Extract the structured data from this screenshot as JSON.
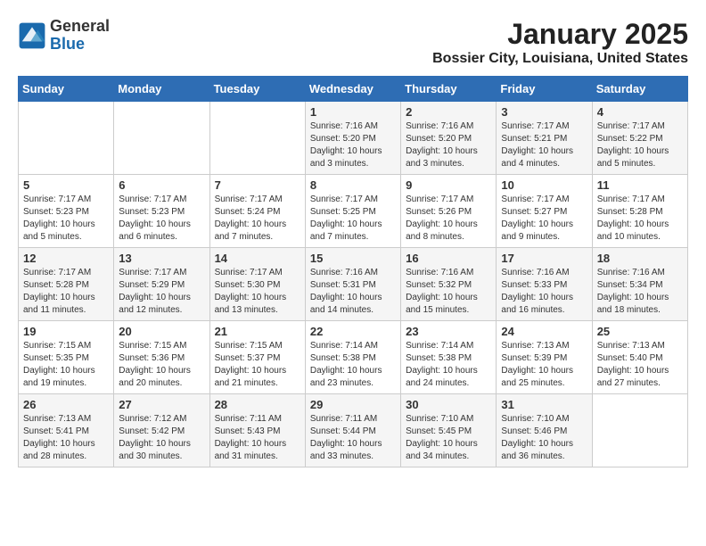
{
  "logo": {
    "general": "General",
    "blue": "Blue"
  },
  "header": {
    "month": "January 2025",
    "location": "Bossier City, Louisiana, United States"
  },
  "weekdays": [
    "Sunday",
    "Monday",
    "Tuesday",
    "Wednesday",
    "Thursday",
    "Friday",
    "Saturday"
  ],
  "weeks": [
    [
      {
        "day": "",
        "info": ""
      },
      {
        "day": "",
        "info": ""
      },
      {
        "day": "",
        "info": ""
      },
      {
        "day": "1",
        "info": "Sunrise: 7:16 AM\nSunset: 5:20 PM\nDaylight: 10 hours\nand 3 minutes."
      },
      {
        "day": "2",
        "info": "Sunrise: 7:16 AM\nSunset: 5:20 PM\nDaylight: 10 hours\nand 3 minutes."
      },
      {
        "day": "3",
        "info": "Sunrise: 7:17 AM\nSunset: 5:21 PM\nDaylight: 10 hours\nand 4 minutes."
      },
      {
        "day": "4",
        "info": "Sunrise: 7:17 AM\nSunset: 5:22 PM\nDaylight: 10 hours\nand 5 minutes."
      }
    ],
    [
      {
        "day": "5",
        "info": "Sunrise: 7:17 AM\nSunset: 5:23 PM\nDaylight: 10 hours\nand 5 minutes."
      },
      {
        "day": "6",
        "info": "Sunrise: 7:17 AM\nSunset: 5:23 PM\nDaylight: 10 hours\nand 6 minutes."
      },
      {
        "day": "7",
        "info": "Sunrise: 7:17 AM\nSunset: 5:24 PM\nDaylight: 10 hours\nand 7 minutes."
      },
      {
        "day": "8",
        "info": "Sunrise: 7:17 AM\nSunset: 5:25 PM\nDaylight: 10 hours\nand 7 minutes."
      },
      {
        "day": "9",
        "info": "Sunrise: 7:17 AM\nSunset: 5:26 PM\nDaylight: 10 hours\nand 8 minutes."
      },
      {
        "day": "10",
        "info": "Sunrise: 7:17 AM\nSunset: 5:27 PM\nDaylight: 10 hours\nand 9 minutes."
      },
      {
        "day": "11",
        "info": "Sunrise: 7:17 AM\nSunset: 5:28 PM\nDaylight: 10 hours\nand 10 minutes."
      }
    ],
    [
      {
        "day": "12",
        "info": "Sunrise: 7:17 AM\nSunset: 5:28 PM\nDaylight: 10 hours\nand 11 minutes."
      },
      {
        "day": "13",
        "info": "Sunrise: 7:17 AM\nSunset: 5:29 PM\nDaylight: 10 hours\nand 12 minutes."
      },
      {
        "day": "14",
        "info": "Sunrise: 7:17 AM\nSunset: 5:30 PM\nDaylight: 10 hours\nand 13 minutes."
      },
      {
        "day": "15",
        "info": "Sunrise: 7:16 AM\nSunset: 5:31 PM\nDaylight: 10 hours\nand 14 minutes."
      },
      {
        "day": "16",
        "info": "Sunrise: 7:16 AM\nSunset: 5:32 PM\nDaylight: 10 hours\nand 15 minutes."
      },
      {
        "day": "17",
        "info": "Sunrise: 7:16 AM\nSunset: 5:33 PM\nDaylight: 10 hours\nand 16 minutes."
      },
      {
        "day": "18",
        "info": "Sunrise: 7:16 AM\nSunset: 5:34 PM\nDaylight: 10 hours\nand 18 minutes."
      }
    ],
    [
      {
        "day": "19",
        "info": "Sunrise: 7:15 AM\nSunset: 5:35 PM\nDaylight: 10 hours\nand 19 minutes."
      },
      {
        "day": "20",
        "info": "Sunrise: 7:15 AM\nSunset: 5:36 PM\nDaylight: 10 hours\nand 20 minutes."
      },
      {
        "day": "21",
        "info": "Sunrise: 7:15 AM\nSunset: 5:37 PM\nDaylight: 10 hours\nand 21 minutes."
      },
      {
        "day": "22",
        "info": "Sunrise: 7:14 AM\nSunset: 5:38 PM\nDaylight: 10 hours\nand 23 minutes."
      },
      {
        "day": "23",
        "info": "Sunrise: 7:14 AM\nSunset: 5:38 PM\nDaylight: 10 hours\nand 24 minutes."
      },
      {
        "day": "24",
        "info": "Sunrise: 7:13 AM\nSunset: 5:39 PM\nDaylight: 10 hours\nand 25 minutes."
      },
      {
        "day": "25",
        "info": "Sunrise: 7:13 AM\nSunset: 5:40 PM\nDaylight: 10 hours\nand 27 minutes."
      }
    ],
    [
      {
        "day": "26",
        "info": "Sunrise: 7:13 AM\nSunset: 5:41 PM\nDaylight: 10 hours\nand 28 minutes."
      },
      {
        "day": "27",
        "info": "Sunrise: 7:12 AM\nSunset: 5:42 PM\nDaylight: 10 hours\nand 30 minutes."
      },
      {
        "day": "28",
        "info": "Sunrise: 7:11 AM\nSunset: 5:43 PM\nDaylight: 10 hours\nand 31 minutes."
      },
      {
        "day": "29",
        "info": "Sunrise: 7:11 AM\nSunset: 5:44 PM\nDaylight: 10 hours\nand 33 minutes."
      },
      {
        "day": "30",
        "info": "Sunrise: 7:10 AM\nSunset: 5:45 PM\nDaylight: 10 hours\nand 34 minutes."
      },
      {
        "day": "31",
        "info": "Sunrise: 7:10 AM\nSunset: 5:46 PM\nDaylight: 10 hours\nand 36 minutes."
      },
      {
        "day": "",
        "info": ""
      }
    ]
  ]
}
